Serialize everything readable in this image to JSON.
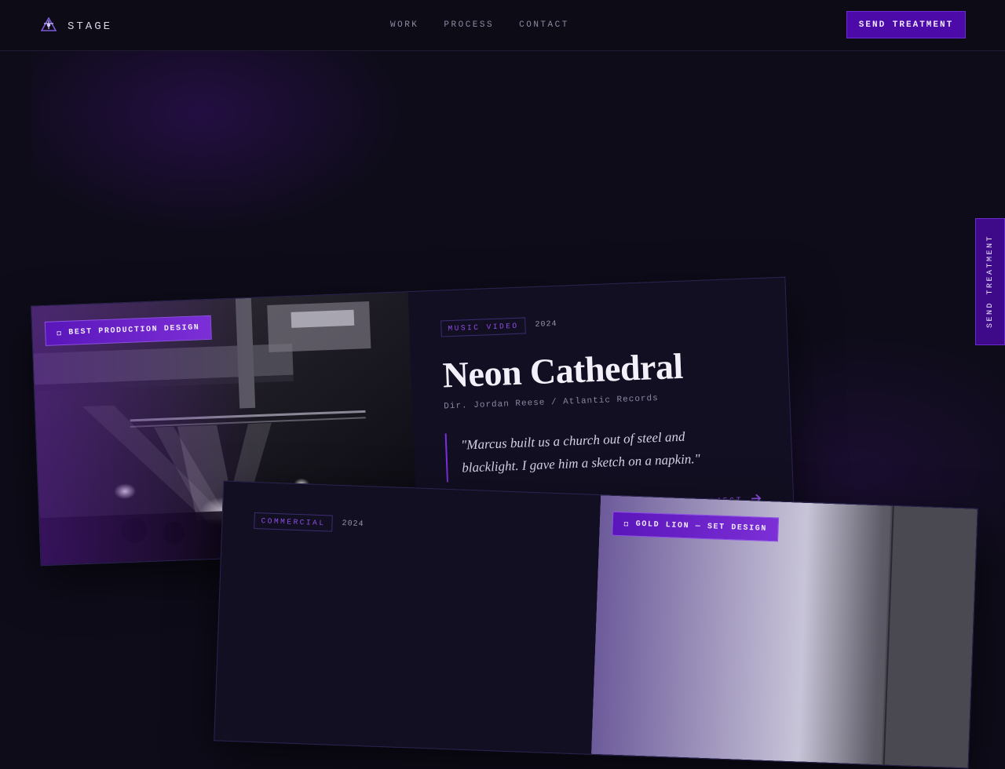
{
  "brand": {
    "name": "STAGE",
    "logo_icon": "stage-logo-icon"
  },
  "nav": {
    "items": [
      {
        "label": "WORK"
      },
      {
        "label": "PROCESS"
      },
      {
        "label": "CONTACT"
      }
    ]
  },
  "header": {
    "cta_label": "SEND TREATMENT"
  },
  "side_tab": {
    "label": "SEND TREATMENT"
  },
  "colors": {
    "accent": "#4c0aa8",
    "accent_light": "#8f4fe6",
    "background": "#0e0c19"
  },
  "projects": [
    {
      "award": "BEST PRODUCTION DESIGN",
      "category": "MUSIC VIDEO",
      "year": "2024",
      "title": "Neon Cathedral",
      "credit": "Dir. Jordan Reese / Atlantic Records",
      "quote": "\"Marcus built us a church out of steel and blacklight. I gave him a sketch on a napkin.\"",
      "link_label": "VIEW PROJECT"
    },
    {
      "award": "GOLD LION — SET DESIGN",
      "category": "COMMERCIAL",
      "year": "2024"
    }
  ]
}
